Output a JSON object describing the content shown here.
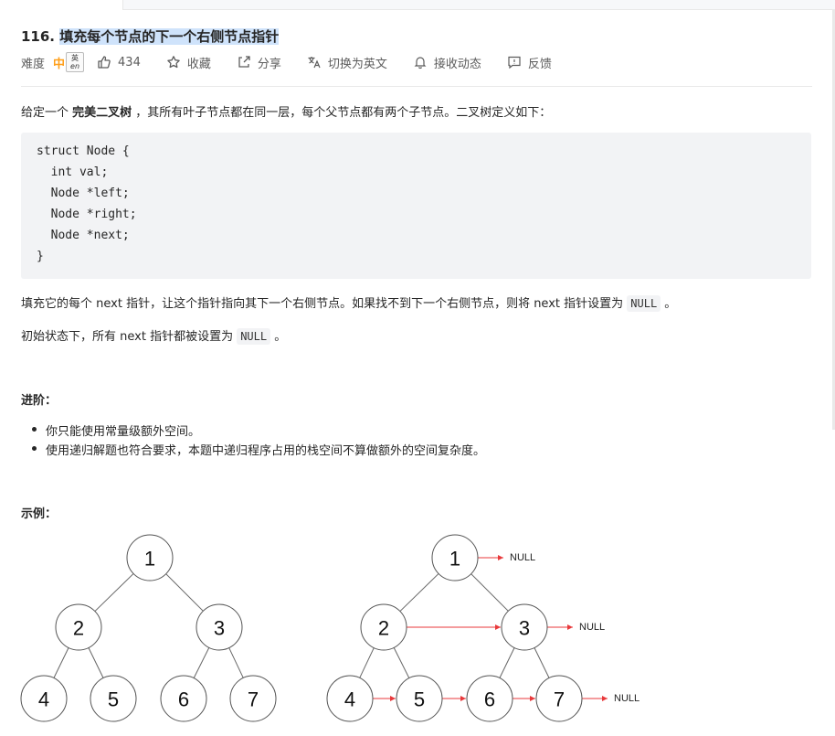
{
  "problem": {
    "number": "116.",
    "title": "填充每个节点的下一个右侧节点指针"
  },
  "meta": {
    "difficulty_label": "难度",
    "difficulty_value": "中",
    "translate_badge_top": "英",
    "translate_badge_bottom": "en",
    "likes": "434",
    "favorite": "收藏",
    "share": "分享",
    "switch_lang": "切换为英文",
    "notify": "接收动态",
    "feedback": "反馈",
    "difficulty_color": "#ff9f1a"
  },
  "description": {
    "intro_prefix": "给定一个 ",
    "intro_bold": "完美二叉树",
    "intro_suffix": " ，其所有叶子节点都在同一层，每个父节点都有两个子节点。二叉树定义如下：",
    "code_lines": [
      "struct Node {",
      "  int val;",
      "  Node *left;",
      "  Node *right;",
      "  Node *next;",
      "}"
    ],
    "para1_prefix": "填充它的每个 next 指针，让这个指针指向其下一个右侧节点。如果找不到下一个右侧节点，则将 next 指针设置为 ",
    "para1_code": "NULL",
    "para1_suffix": " 。",
    "para2_prefix": "初始状态下，所有 next 指针都被设置为 ",
    "para2_code": "NULL",
    "para2_suffix": " 。"
  },
  "advanced": {
    "heading": "进阶：",
    "items": [
      "你只能使用常量级额外空间。",
      "使用递归解题也符合要求，本题中递归程序占用的栈空间不算做额外的空间复杂度。"
    ]
  },
  "example": {
    "heading": "示例：",
    "left_tree_nodes": [
      "1",
      "2",
      "3",
      "4",
      "5",
      "6",
      "7"
    ],
    "right_tree_nodes": [
      "1",
      "2",
      "3",
      "4",
      "5",
      "6",
      "7"
    ],
    "null_label": "NULL",
    "arrow_color": "#e8393b"
  }
}
